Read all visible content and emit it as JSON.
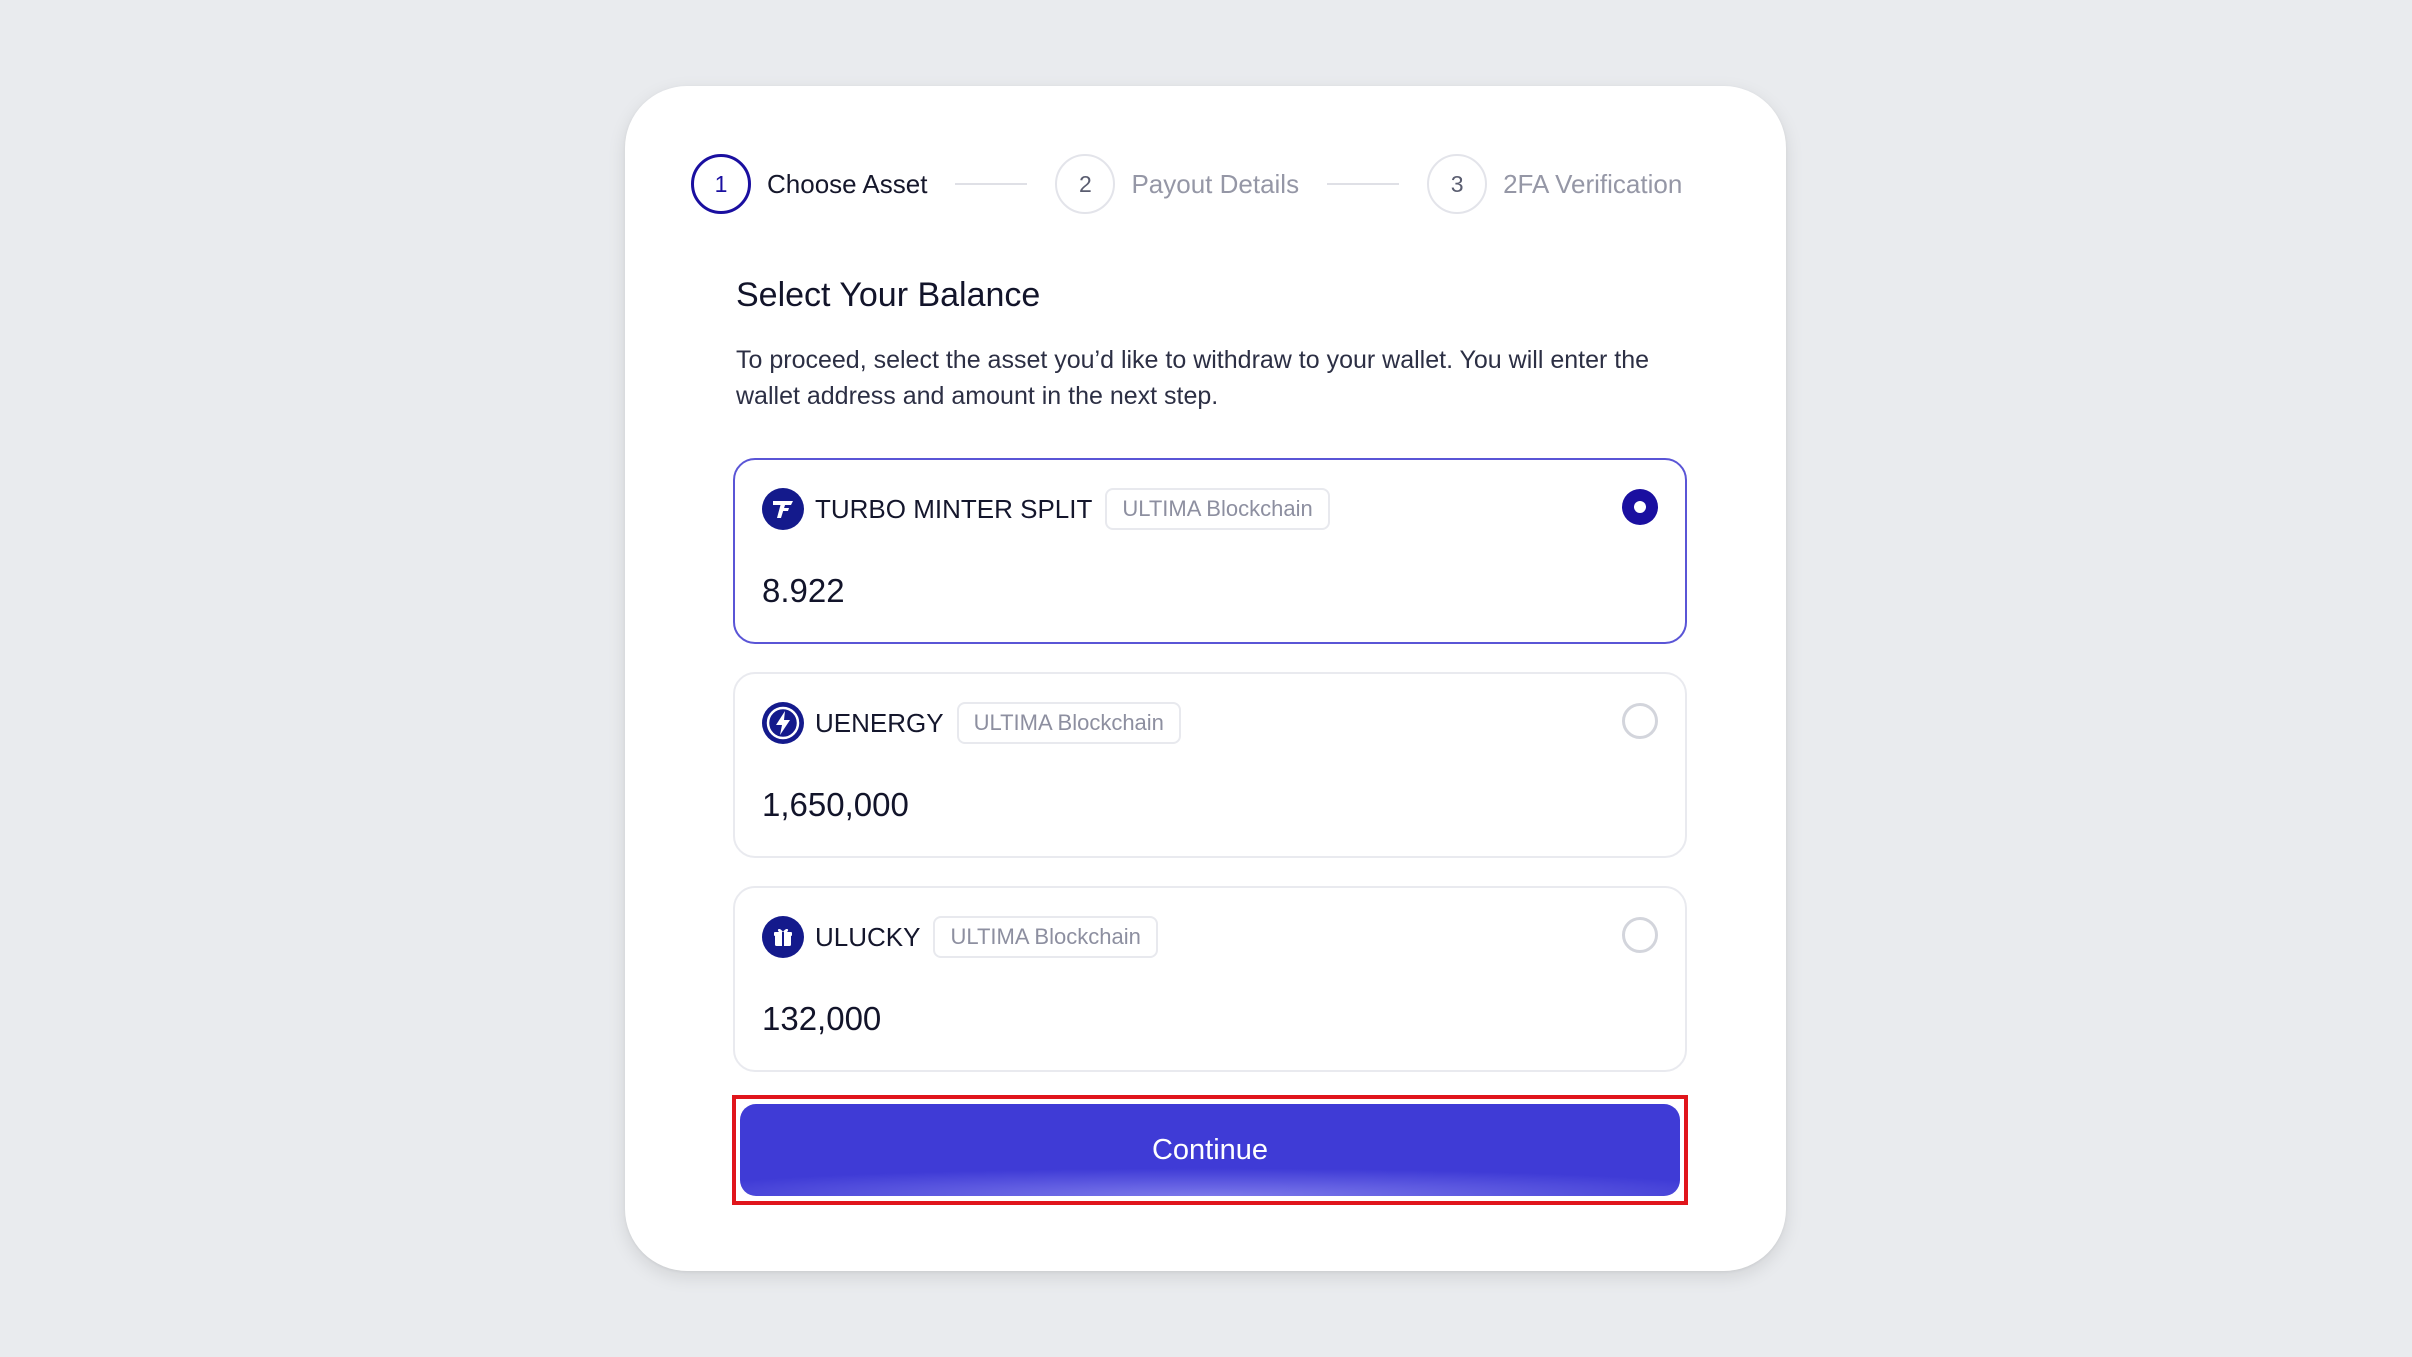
{
  "stepper": {
    "steps": [
      {
        "number": "1",
        "label": "Choose Asset",
        "active": true
      },
      {
        "number": "2",
        "label": "Payout Details",
        "active": false
      },
      {
        "number": "3",
        "label": "2FA Verification",
        "active": false
      }
    ]
  },
  "heading": {
    "title": "Select Your Balance",
    "description": "To proceed, select the asset you’d like to withdraw to your wallet. You will enter the wallet address and amount in the next step."
  },
  "assets": [
    {
      "name": "TURBO MINTER SPLIT",
      "chain": "ULTIMA Blockchain",
      "amount": "8.922",
      "icon": "turbo-logo-icon",
      "selected": true
    },
    {
      "name": "UENERGY",
      "chain": "ULTIMA Blockchain",
      "amount": "1,650,000",
      "icon": "lightning-icon",
      "selected": false
    },
    {
      "name": "ULUCKY",
      "chain": "ULTIMA Blockchain",
      "amount": "132,000",
      "icon": "gift-icon",
      "selected": false
    }
  ],
  "actions": {
    "continue_label": "Continue"
  },
  "colors": {
    "primary": "#1a0fa0",
    "button": "#3f3bd6",
    "highlight_border": "#e0151c"
  }
}
